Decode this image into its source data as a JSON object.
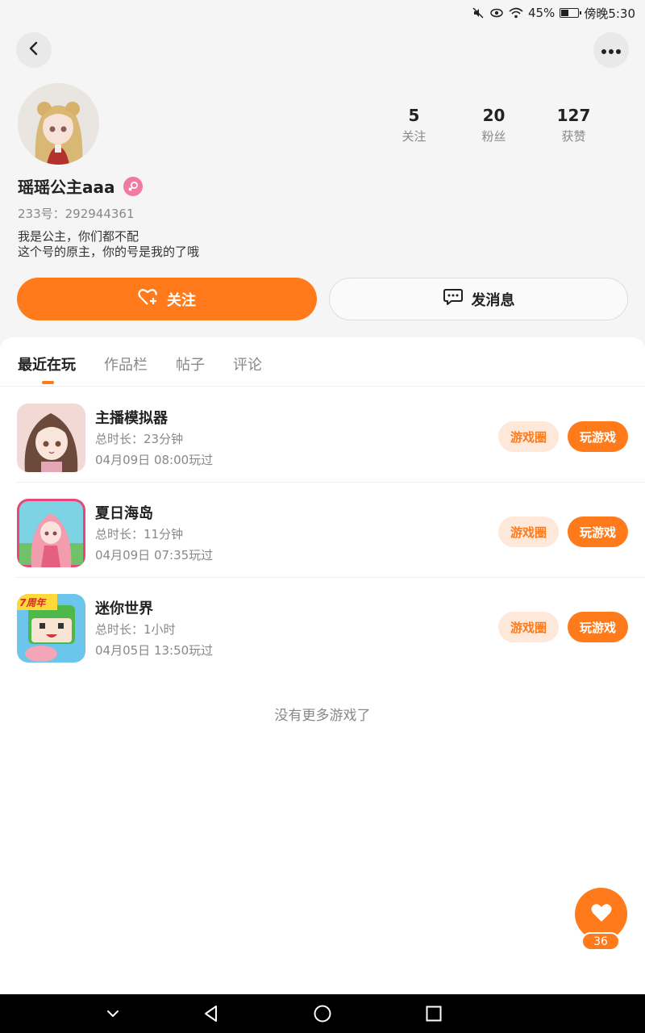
{
  "status_bar": {
    "battery_percent": "45%",
    "battery_level": 0.45,
    "time": "傍晚5:30",
    "icons": [
      "mute-icon",
      "eye-icon",
      "wifi-icon",
      "battery-icon"
    ]
  },
  "header": {
    "back_icon": "chevron-left-icon",
    "more_icon": "more-dots-icon"
  },
  "profile": {
    "avatar_icon": "avatar",
    "stats": [
      {
        "value": "5",
        "label": "关注"
      },
      {
        "value": "20",
        "label": "粉丝"
      },
      {
        "value": "127",
        "label": "获赞"
      }
    ],
    "username": "瑶瑶公主aaa",
    "gender_icon": "female-icon",
    "uid": "233号：292944361",
    "bio_line1": "我是公主，你们都不配",
    "bio_line2": "这个号的原主，你的号是我的了哦"
  },
  "actions": {
    "follow_label": "关注",
    "message_label": "发消息"
  },
  "tabs": [
    {
      "label": "最近在玩",
      "active": true
    },
    {
      "label": "作品栏",
      "active": false
    },
    {
      "label": "帖子",
      "active": false
    },
    {
      "label": "评论",
      "active": false
    }
  ],
  "games": [
    {
      "name": "主播模拟器",
      "duration": "总时长：23分钟",
      "last_played": "04月09日 08:00玩过",
      "circle_label": "游戏圈",
      "play_label": "玩游戏"
    },
    {
      "name": "夏日海岛",
      "duration": "总时长：11分钟",
      "last_played": "04月09日 07:35玩过",
      "circle_label": "游戏圈",
      "play_label": "玩游戏"
    },
    {
      "name": "迷你世界",
      "duration": "总时长：1小时",
      "last_played": "04月05日 13:50玩过",
      "circle_label": "游戏圈",
      "play_label": "玩游戏",
      "badge": "7周年"
    }
  ],
  "no_more_text": "没有更多游戏了",
  "like_fab": {
    "count": "36",
    "icon": "heart-icon"
  },
  "colors": {
    "accent": "#ff7a1a",
    "accent_light": "#fde8d9",
    "pink": "#f07aa1"
  }
}
